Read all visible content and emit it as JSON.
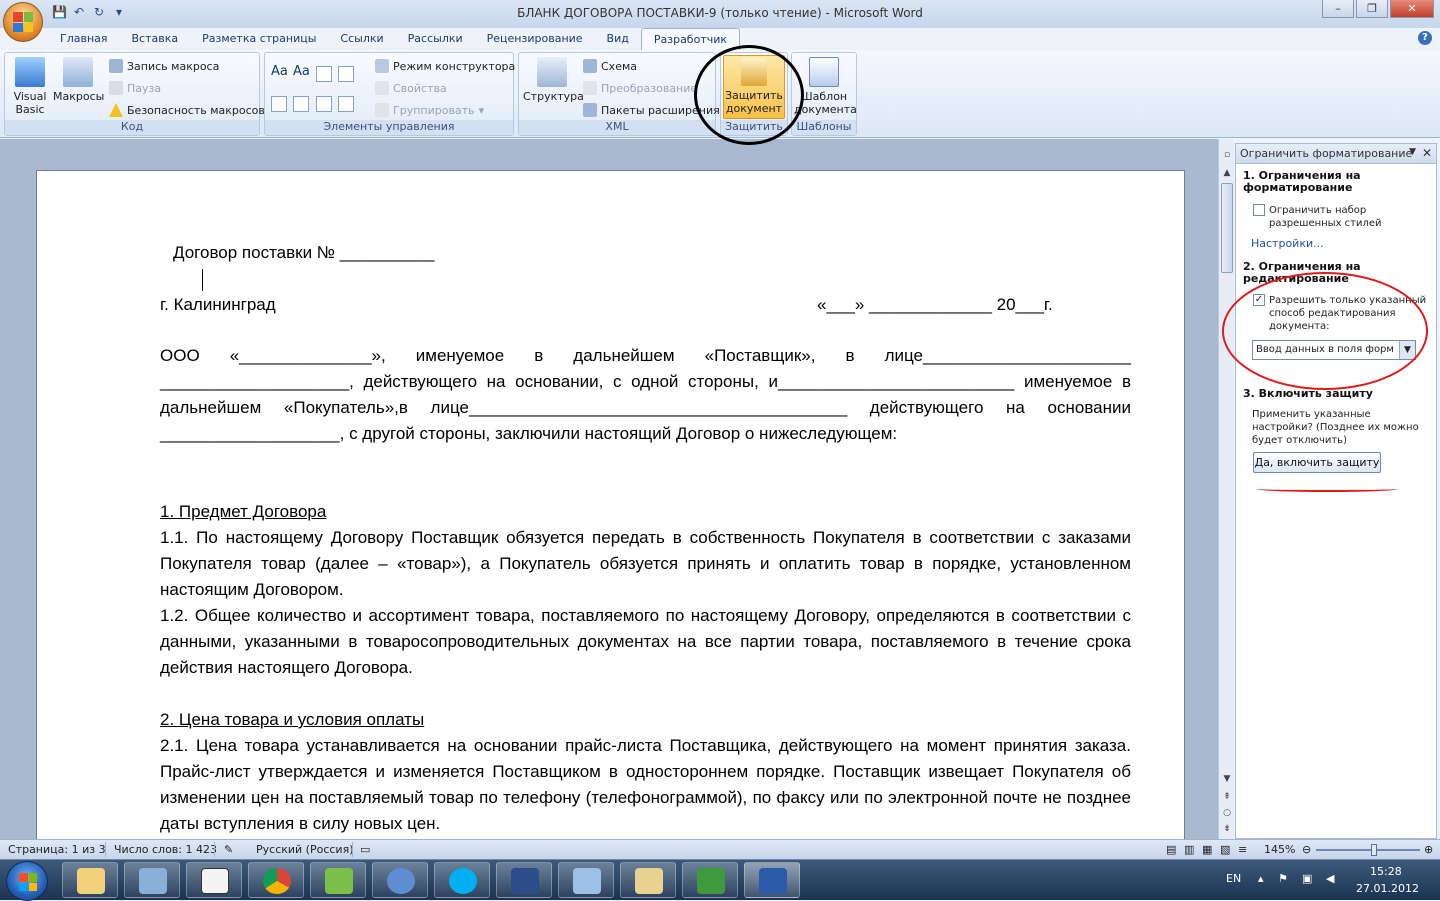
{
  "window": {
    "title": "БЛАНК ДОГОВОРА ПОСТАВКИ-9 (только чтение)  -  Microsoft Word",
    "minimize": "–",
    "maximize": "❐",
    "close": "✕"
  },
  "qat": {
    "save": "💾",
    "undo": "↶",
    "redo": "↻",
    "more": "▾"
  },
  "tabs": [
    "Главная",
    "Вставка",
    "Разметка страницы",
    "Ссылки",
    "Рассылки",
    "Рецензирование",
    "Вид",
    "Разработчик"
  ],
  "active_tab": "Разработчик",
  "help": "?",
  "ribbon": {
    "code": {
      "label": "Код",
      "visual_basic": "Visual Basic",
      "macros": "Макросы",
      "record": "Запись макроса",
      "pause": "Пауза",
      "security": "Безопасность макросов"
    },
    "controls": {
      "label": "Элементы управления",
      "aa1": "Aa",
      "aa2": "Aa",
      "design_mode": "Режим конструктора",
      "properties": "Свойства",
      "group": "Группировать"
    },
    "xml": {
      "label": "XML",
      "structure": "Структура",
      "schema": "Схема",
      "transform": "Преобразование",
      "packs": "Пакеты расширения"
    },
    "protect": {
      "label": "Защитить",
      "protect_doc": "Защитить документ"
    },
    "templates": {
      "label": "Шаблоны",
      "doc_template": "Шаблон документа"
    }
  },
  "document": {
    "title": "Договор поставки № __________",
    "city": "г. Калининград",
    "date": "«___» _____________  20___г.",
    "para_intro": "ООО «______________», именуемое в дальнейшем «Поставщик», в лице______________________ ____________________, действующего на основании, с одной стороны, и_________________________ именуемое в дальнейшем «Покупатель»,в лице________________________________________ действующего на основании ___________________, с другой стороны, заключили настоящий Договор о нижеследующем:",
    "s1_heading": "1. Предмет Договора",
    "s1_p1": "1.1. По настоящему Договору Поставщик обязуется передать в собственность Покупателя в соответствии с заказами Покупателя товар (далее – «товар»), а Покупатель обязуется принять и оплатить товар в порядке, установленном настоящим Договором.",
    "s1_p2": "1.2. Общее количество и ассортимент товара, поставляемого по настоящему Договору, определяются в соответствии с данными, указанными в товаросопроводительных документах на все партии товара, поставляемого в течение срока действия настоящего Договора.",
    "s2_heading": "2. Цена товара и условия оплаты",
    "s2_p1": "2.1. Цена товара устанавливается на основании прайс-листа Поставщика, действующего на момент принятия заказа. Прайс-лист утверждается и изменяется Поставщиком в одностороннем порядке. Поставщик извещает Покупателя об изменении цен на поставляемый товар по телефону (телефонограммой), по факсу или по электронной почте не позднее даты вступления в силу новых цен."
  },
  "pane": {
    "title": "Ограничить форматирование",
    "close": "✕",
    "s1": "1. Ограничения на форматирование",
    "s1_check": "Ограничить набор разрешенных стилей",
    "s1_checked": false,
    "s1_link": "Настройки...",
    "s2": "2. Ограничения на редактирование",
    "s2_check": "Разрешить только указанный способ редактирования документа:",
    "s2_checked": true,
    "s2_select": "Ввод данных в поля форм",
    "s3": "3. Включить защиту",
    "s3_text": "Применить указанные настройки? (Позднее их можно будет отключить)",
    "s3_button": "Да, включить защиту"
  },
  "status": {
    "page": "Страница: 1 из 3",
    "words": "Число слов: 1 423",
    "language": "Русский (Россия)",
    "zoom": "145%",
    "zoom_level": 0.56
  },
  "taskbar": {
    "lang": "EN",
    "time": "15:28",
    "date": "27.01.2012",
    "apps": [
      "explorer",
      "network",
      "vnc",
      "chrome",
      "recycle",
      "thunderbird",
      "skype",
      "library",
      "computer",
      "folder",
      "excel",
      "word"
    ]
  },
  "colors": {
    "annotation_black": "#000000",
    "annotation_red": "#e01a1a",
    "link": "#1f4fa8"
  }
}
